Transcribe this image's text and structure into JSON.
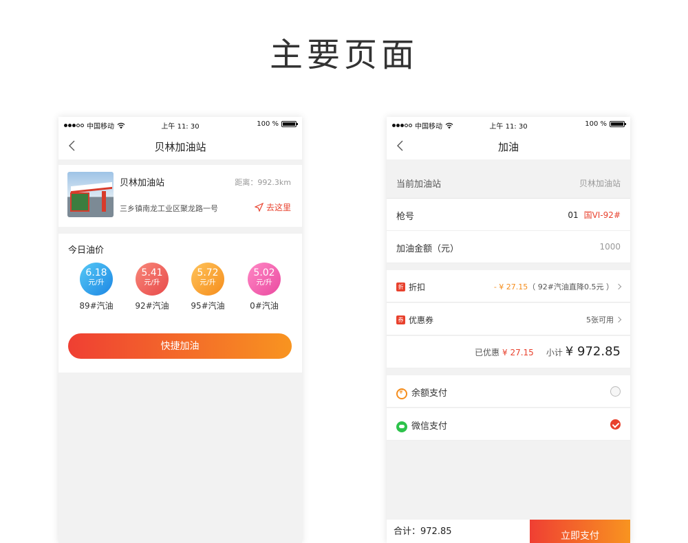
{
  "page_title": "主要页面",
  "status": {
    "carrier": "中国移动",
    "time": "上午 11: 30",
    "battery": "100 %"
  },
  "left": {
    "nav_title": "贝林加油站",
    "station": {
      "name": "贝林加油站",
      "distance": "距离：992.3km",
      "address": "三乡镇南龙工业区聚龙路一号",
      "goto": "去这里"
    },
    "prices_title": "今日油价",
    "prices": [
      {
        "value": "6.18",
        "unit": "元/升",
        "name": "89#汽油",
        "color": "#1d87e4"
      },
      {
        "value": "5.41",
        "unit": "元/升",
        "name": "92#汽油",
        "color": "#e84a4a"
      },
      {
        "value": "5.72",
        "unit": "元/升",
        "name": "95#汽油",
        "color": "#f58d1c"
      },
      {
        "value": "5.02",
        "unit": "元/升",
        "name": "0#汽油",
        "color": "#ea4aa0"
      }
    ],
    "quick_button": "快捷加油"
  },
  "right": {
    "nav_title": "加油",
    "current_station_label": "当前加油站",
    "current_station_value": "贝林加油站",
    "gun_label": "枪号",
    "gun_number": "01",
    "gun_grade": "国VI-92#",
    "amount_label": "加油金额（元）",
    "amount_value": "1000",
    "discount_tag": "折",
    "discount_label": "折扣",
    "discount_amount": "- ¥ 27.15",
    "discount_note": "（ 92#汽油直降0.5元 ）",
    "coupon_tag": "券",
    "coupon_label": "优惠券",
    "coupon_value": "5张可用",
    "saved_label": "已优惠",
    "saved_value": "¥ 27.15",
    "subtotal_label": "小计",
    "subtotal_value": "¥ 972.85",
    "pay_balance": "余额支付",
    "pay_wechat": "微信支付",
    "total_text": "合计：972.85",
    "pay_button": "立即支付"
  },
  "colors": {
    "accent_red": "#e8412d",
    "accent_orange": "#f89420",
    "wechat_green": "#2dc24b"
  }
}
